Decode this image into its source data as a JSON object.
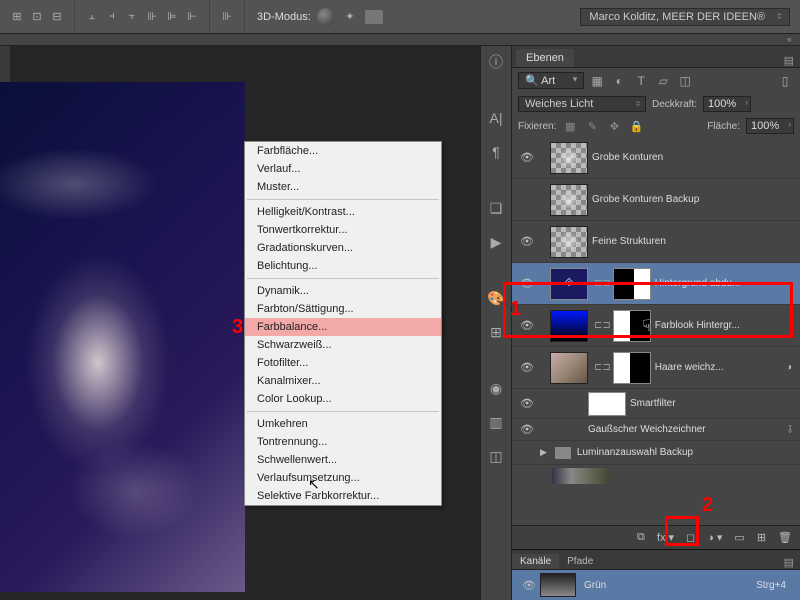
{
  "topbar": {
    "mode_label": "3D-Modus:",
    "workspace": "Marco Kolditz, MEER DER IDEEN®"
  },
  "context_menu": {
    "groups": [
      [
        "Farbfläche...",
        "Verlauf...",
        "Muster..."
      ],
      [
        "Helligkeit/Kontrast...",
        "Tonwertkorrektur...",
        "Gradationskurven...",
        "Belichtung..."
      ],
      [
        "Dynamik...",
        "Farbton/Sättigung...",
        "Farbbalance...",
        "Schwarzweiß...",
        "Fotofilter...",
        "Kanalmixer...",
        "Color Lookup..."
      ],
      [
        "Umkehren",
        "Tontrennung...",
        "Schwellenwert...",
        "Verlaufsumsetzung...",
        "Selektive Farbkorrektur..."
      ]
    ],
    "highlighted": "Farbbalance..."
  },
  "markers": {
    "m1": "1",
    "m2": "2",
    "m3": "3"
  },
  "layers_panel": {
    "tab": "Ebenen",
    "kind_filter": "Art",
    "blend_mode": "Weiches Licht",
    "opacity_label": "Deckkraft:",
    "opacity_value": "100%",
    "lock_label": "Fixieren:",
    "fill_label": "Fläche:",
    "fill_value": "100%",
    "layers": [
      {
        "name": "Grobe Konturen",
        "thumb": "checker",
        "visible": true
      },
      {
        "name": "Grobe Konturen Backup",
        "thumb": "checker",
        "visible": false
      },
      {
        "name": "Feine Strukturen",
        "thumb": "checker",
        "visible": true
      },
      {
        "name": "Hintergrund abdu...",
        "thumb": "adj",
        "mask": "mask-blackL",
        "visible": true,
        "selected": true
      },
      {
        "name": "Farblook Hintergr...",
        "thumb": "blue-grad",
        "mask": "mask-half",
        "visible": true
      },
      {
        "name": "Haare weichz...",
        "thumb": "photo1",
        "mask": "mask-half",
        "visible": true,
        "fx": true
      }
    ],
    "smartfilter_label": "Smartfilter",
    "smartfilter_item": "Gaußscher Weichzeichner",
    "group_name": "Luminanzauswahl Backup"
  },
  "channels_panel": {
    "tab1": "Kanäle",
    "tab2": "Pfade",
    "channel_name": "Grün",
    "channel_shortcut": "Strg+4"
  }
}
